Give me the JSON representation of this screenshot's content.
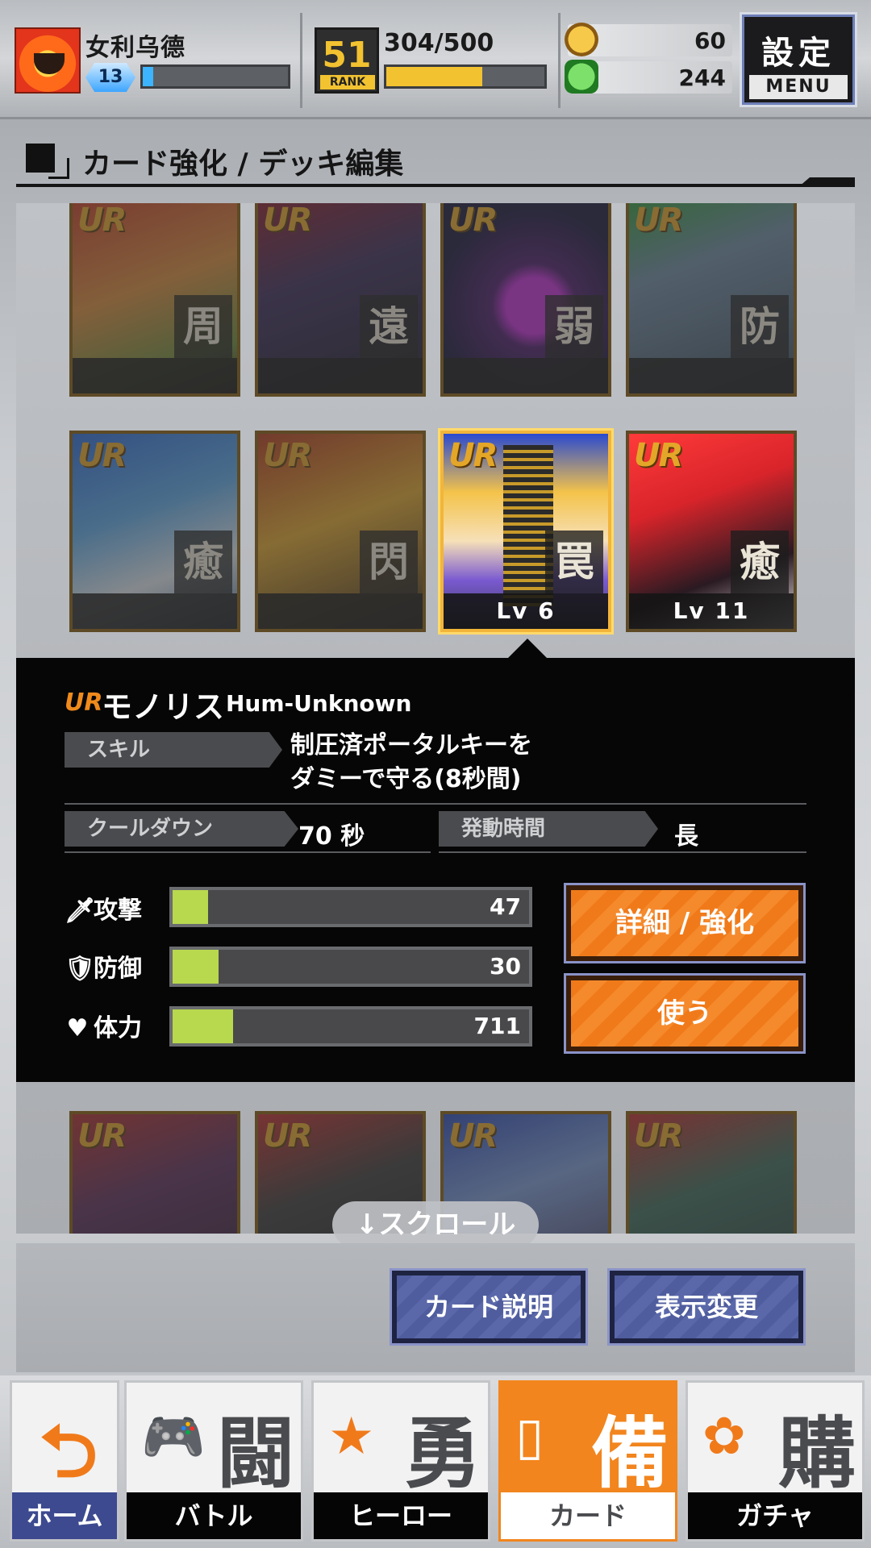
{
  "header": {
    "username": "女利乌德",
    "level": "13",
    "xp_fraction": 0.07,
    "rank_number": "51",
    "rank_label": "RANK",
    "rank_progress": "304/500",
    "rank_fraction": 0.608,
    "gold_coins": "60",
    "green_coins": "244",
    "menu_main": "設定",
    "menu_sub": "MENU"
  },
  "section": {
    "title": "カード強化 / デッキ編集"
  },
  "cards": {
    "rarity": "UR",
    "row1": [
      {
        "kanji": "周",
        "art": "art-red"
      },
      {
        "kanji": "遠",
        "art": "art-purple"
      },
      {
        "kanji": "弱",
        "art": "art-magic"
      },
      {
        "kanji": "防",
        "art": "art-city"
      }
    ],
    "row2": [
      {
        "kanji": "癒",
        "art": "art-blue"
      },
      {
        "kanji": "閃",
        "art": "art-gold"
      },
      {
        "kanji": "罠",
        "level": "Lv 6",
        "art": "art-mono"
      },
      {
        "kanji": "癒",
        "level": "Lv 11",
        "art": "art-heroine"
      }
    ]
  },
  "detail": {
    "rarity": "UR",
    "name": "モノリス",
    "name_en": "Hum-Unknown",
    "skill_label": "スキル",
    "skill_text_1": "制圧済ポータルキーを",
    "skill_text_2": "ダミーで守る(8秒間)",
    "cooldown_label": "クールダウン",
    "cooldown_value": "70 秒",
    "duration_label": "発動時間",
    "duration_value": "長",
    "stats": [
      {
        "icon": "🗡",
        "label": "攻撃",
        "value": "47",
        "fraction": 0.1
      },
      {
        "icon": "🛡",
        "label": "防御",
        "value": "30",
        "fraction": 0.13
      },
      {
        "icon": "♥",
        "label": "体力",
        "value": "711",
        "fraction": 0.17
      }
    ],
    "detail_button": "詳細 / 強化",
    "use_button": "使う"
  },
  "scroll_hint": "↓スクロール",
  "footer_buttons": {
    "card_description": "カード説明",
    "display_change": "表示変更"
  },
  "nav": [
    {
      "label": "ホーム",
      "kanji": "",
      "icon": "return-icon"
    },
    {
      "label": "バトル",
      "kanji": "闘",
      "icon": "gamepad-icon"
    },
    {
      "label": "ヒーロー",
      "kanji": "勇",
      "icon": "hero-icon"
    },
    {
      "label": "カード",
      "kanji": "備",
      "icon": "cards-icon"
    },
    {
      "label": "ガチャ",
      "kanji": "購",
      "icon": "gacha-icon"
    }
  ],
  "colors": {
    "accent": "#f2851e",
    "stat_bar": "#b8d84e",
    "blue_button": "#4f5d9e"
  }
}
